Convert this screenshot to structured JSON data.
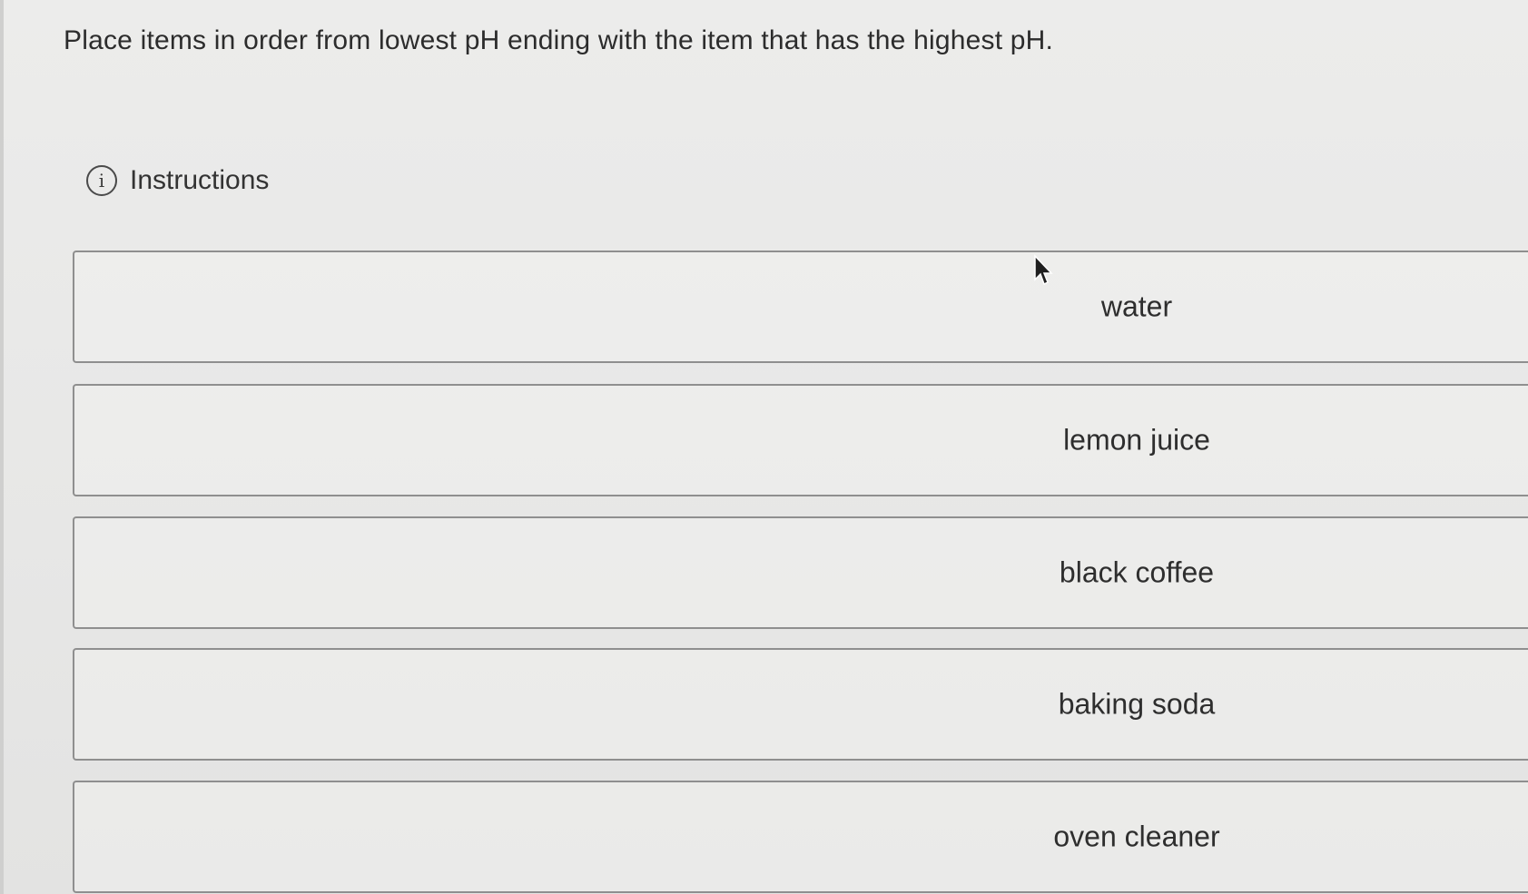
{
  "question": {
    "text": "Place items in order from lowest pH ending with the item that has the highest pH."
  },
  "instructions": {
    "icon": "info-icon",
    "label": "Instructions"
  },
  "sort_items": [
    {
      "label": "water"
    },
    {
      "label": "lemon juice"
    },
    {
      "label": "black coffee"
    },
    {
      "label": "baking soda"
    },
    {
      "label": "oven cleaner"
    }
  ]
}
